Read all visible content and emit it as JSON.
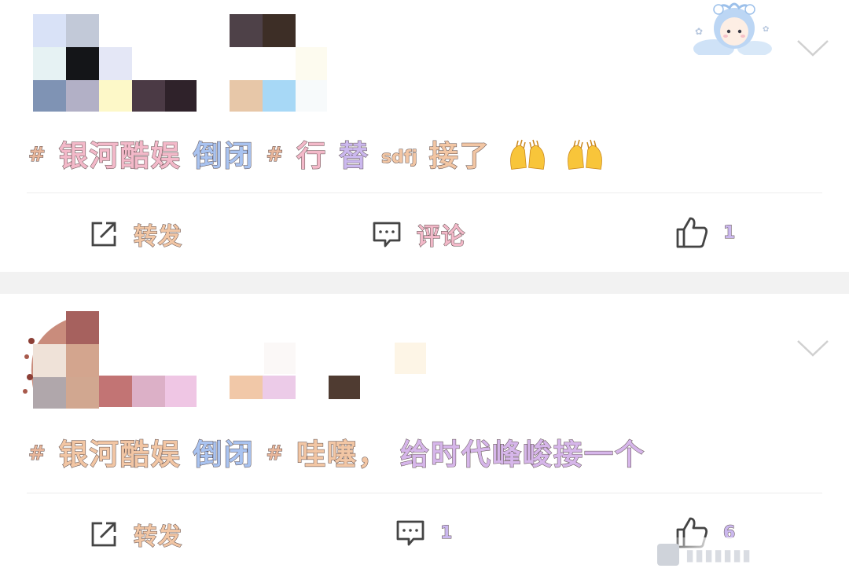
{
  "post1": {
    "content": {
      "hash1": "#",
      "part1": "银河酷娱",
      "part2": "倒闭",
      "hash2": "#",
      "part3": "行",
      "part4": "替",
      "part5": "sdfj",
      "part6": "接了"
    },
    "emoji": "folded-hands-emoji",
    "actions": {
      "repost_label": "转发",
      "comment_label": "评论",
      "like_count": "1"
    }
  },
  "post2": {
    "content": {
      "hash1": "#",
      "part1": "银河酷娱",
      "part2": "倒闭",
      "hash2": "#",
      "part3": "哇噻，",
      "part4": "给时代峰峻接一个"
    },
    "actions": {
      "repost_label": "转发",
      "comment_count": "1",
      "like_count": "6"
    }
  },
  "colors": {
    "pink": "#f3b9c9",
    "blue": "#a9c3f0",
    "peach": "#f2c6a4",
    "purple": "#cbb8ee",
    "separator": "#f2f2f2"
  }
}
